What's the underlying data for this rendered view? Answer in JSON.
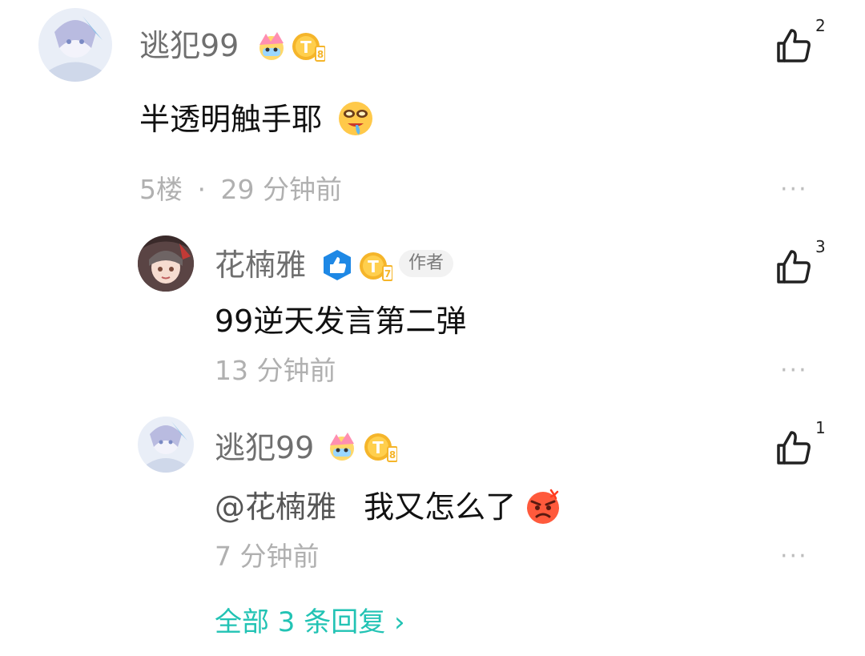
{
  "comments": {
    "main": {
      "username": "逃犯99",
      "text": "半透明触手耶",
      "floor": "5楼",
      "separator": "·",
      "time": "29 分钟前",
      "likes": "2",
      "more": "···",
      "level_badge": "8"
    },
    "replies": [
      {
        "username": "花楠雅",
        "author_tag": "作者",
        "text": "99逆天发言第二弹",
        "time": "13 分钟前",
        "likes": "3",
        "more": "···",
        "level_badge": "7"
      },
      {
        "username": "逃犯99",
        "mention": "@花楠雅",
        "text": "我又怎么了",
        "time": "7 分钟前",
        "likes": "1",
        "more": "···",
        "level_badge": "8"
      }
    ],
    "view_all": "全部 3 条回复 ›"
  },
  "colors": {
    "accent": "#22c3b4",
    "username": "#6f6f6f",
    "meta": "#b0b0b0",
    "badge_gold": "#f5b52a",
    "verified_blue": "#1e88e5",
    "emoji_red": "#ff5a3c"
  }
}
